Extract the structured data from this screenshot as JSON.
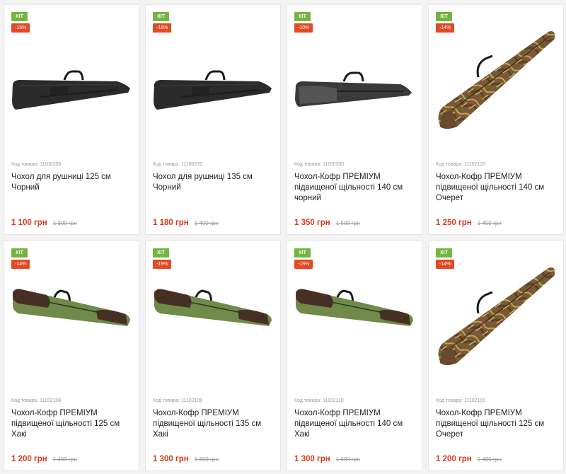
{
  "products": [
    {
      "hit": "ХІТ",
      "discount": "-15%",
      "code": "Код товара: 11100258",
      "title": "Чохол для рушниці 125 см Чорний",
      "price": "1 100 грн",
      "old_price": "1 300 грн",
      "image": "black-case"
    },
    {
      "hit": "ХІТ",
      "discount": "-16%",
      "code": "Код товара: 11100270",
      "title": "Чохол для рушниці 135 см Чорний",
      "price": "1 180 грн",
      "old_price": "1 400 грн",
      "image": "black-case"
    },
    {
      "hit": "ХІТ",
      "discount": "-10%",
      "code": "Код товара: 11100200",
      "title": "Чохол-Кофр ПРЕМІУМ підвищеної щільності 140 см чорний",
      "price": "1 350 грн",
      "old_price": "1 500 грн",
      "image": "black-premium-case"
    },
    {
      "hit": "ХІТ",
      "discount": "-14%",
      "code": "Код товара: 11102120",
      "title": "Чохол-Кофр ПРЕМІУМ підвищеної щільності 140 см Очерет",
      "price": "1 250 грн",
      "old_price": "1 450 грн",
      "image": "camo-case"
    },
    {
      "hit": "ХІТ",
      "discount": "-14%",
      "code": "Код товара: 11102108",
      "title": "Чохол-Кофр ПРЕМІУМ підвищеної щільності 125 см Хакі",
      "price": "1 200 грн",
      "old_price": "1 400 грн",
      "image": "khaki-case"
    },
    {
      "hit": "ХІТ",
      "discount": "-19%",
      "code": "Код товара: 11102109",
      "title": "Чохол-Кофр ПРЕМІУМ підвищеної щільності 135 см Хакі",
      "price": "1 300 грн",
      "old_price": "1 600 грн",
      "image": "khaki-case"
    },
    {
      "hit": "ХІТ",
      "discount": "-19%",
      "code": "Код товара: 11102110",
      "title": "Чохол-Кофр ПРЕМІУМ підвищеної щільності 140 см Хакі",
      "price": "1 300 грн",
      "old_price": "1 600 грн",
      "image": "khaki-case"
    },
    {
      "hit": "ХІТ",
      "discount": "-14%",
      "code": "Код товара: 11102116",
      "title": "Чохол-Кофр ПРЕМІУМ підвищеної щільності 125 см Очерет",
      "price": "1 200 грн",
      "old_price": "1 400 грн",
      "image": "camo-case"
    }
  ],
  "colors": {
    "hit": "#74b540",
    "discount": "#e34a24",
    "price": "#d53a1d"
  }
}
